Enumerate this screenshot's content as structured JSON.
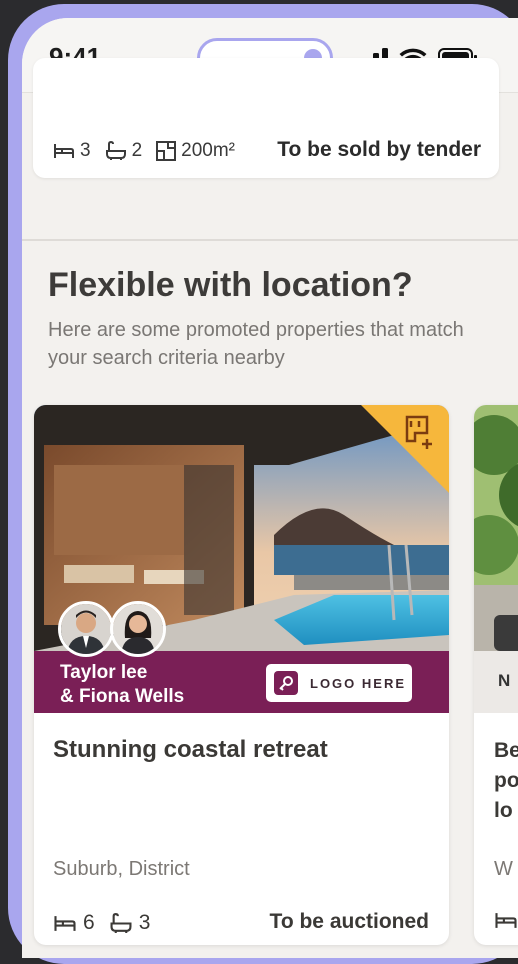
{
  "status_bar": {
    "time": "9:41"
  },
  "previous_listing": {
    "beds": "3",
    "baths": "2",
    "area": "200m²",
    "sale_method": "To be sold by tender"
  },
  "section": {
    "title": "Flexible with location?",
    "subtitle": "Here are some promoted properties that match your search criteria nearby"
  },
  "listing": {
    "agent_line1": "Taylor lee",
    "agent_line2": "& Fiona Wells",
    "agency_logo_text": "LOGO HERE",
    "title": "Stunning coastal retreat",
    "location": "Suburb, District",
    "beds": "6",
    "baths": "3",
    "sale_method": "To be auctioned",
    "promo_icon": "building-plus-icon"
  },
  "next_listing": {
    "bar_letter": "N",
    "title_partial": "Be\npo\nlo",
    "location_partial": "W"
  },
  "colors": {
    "accent_frame": "#a9a6ee",
    "agency_brand": "#7a1f56",
    "promo_corner": "#f6b73c"
  }
}
